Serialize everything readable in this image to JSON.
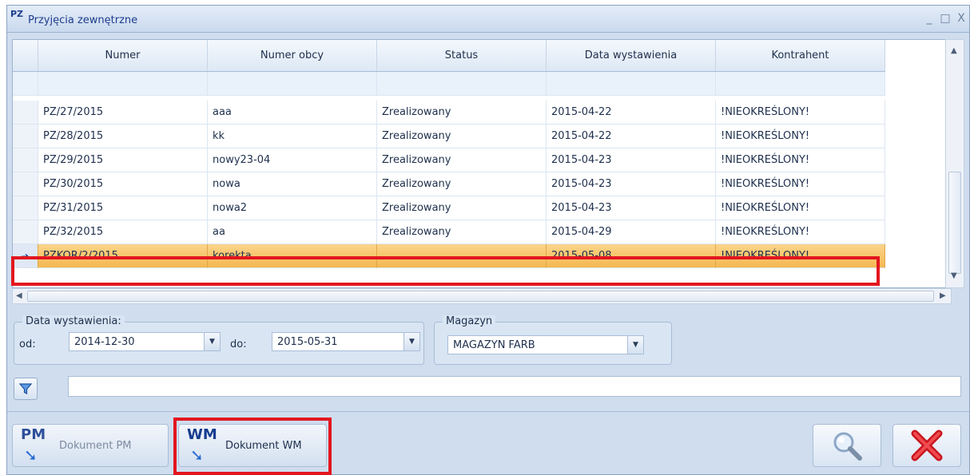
{
  "window": {
    "icon_text": "PZ",
    "title": "Przyjęcia zewnętrzne",
    "controls": [
      "_",
      "□",
      "X"
    ]
  },
  "grid": {
    "columns": [
      "Numer",
      "Numer obcy",
      "Status",
      "Data wystawienia",
      "Kontrahent"
    ],
    "rows": [
      {
        "numer": "PZ/27/2015",
        "numer_obcy": "aaa",
        "status": "Zrealizowany",
        "data": "2015-04-22",
        "kontrahent": "!NIEOKREŚLONY!"
      },
      {
        "numer": "PZ/28/2015",
        "numer_obcy": "kk",
        "status": "Zrealizowany",
        "data": "2015-04-22",
        "kontrahent": "!NIEOKREŚLONY!"
      },
      {
        "numer": "PZ/29/2015",
        "numer_obcy": "nowy23-04",
        "status": "Zrealizowany",
        "data": "2015-04-23",
        "kontrahent": "!NIEOKREŚLONY!"
      },
      {
        "numer": "PZ/30/2015",
        "numer_obcy": "nowa",
        "status": "Zrealizowany",
        "data": "2015-04-23",
        "kontrahent": "!NIEOKREŚLONY!"
      },
      {
        "numer": "PZ/31/2015",
        "numer_obcy": "nowa2",
        "status": "Zrealizowany",
        "data": "2015-04-23",
        "kontrahent": "!NIEOKREŚLONY!"
      },
      {
        "numer": "PZ/32/2015",
        "numer_obcy": "aa",
        "status": "Zrealizowany",
        "data": "2015-04-29",
        "kontrahent": "!NIEOKREŚLONY!"
      },
      {
        "numer": "PZKOR/2/2015",
        "numer_obcy": "korekta",
        "status": "",
        "data": "2015-05-08",
        "kontrahent": "!NIEOKREŚLONY!"
      }
    ],
    "selected_row_index": 6,
    "highlight_color": "#e3161f"
  },
  "filters": {
    "date_group_label": "Data wystawienia:",
    "from_label": "od:",
    "from_value": "2014-12-30",
    "to_label": "do:",
    "to_value": "2015-05-31",
    "warehouse_group_label": "Magazyn",
    "warehouse_value": "MAGAZYN FARB"
  },
  "search": {
    "value": ""
  },
  "actions": {
    "pm": {
      "icon_text": "PM",
      "label": "Dokument PM",
      "enabled": false
    },
    "wm": {
      "icon_text": "WM",
      "label": "Dokument WM",
      "enabled": true
    }
  },
  "colors": {
    "selected_row": "#f4b851",
    "highlight": "#e3161f",
    "text": "#1e2f4d"
  }
}
